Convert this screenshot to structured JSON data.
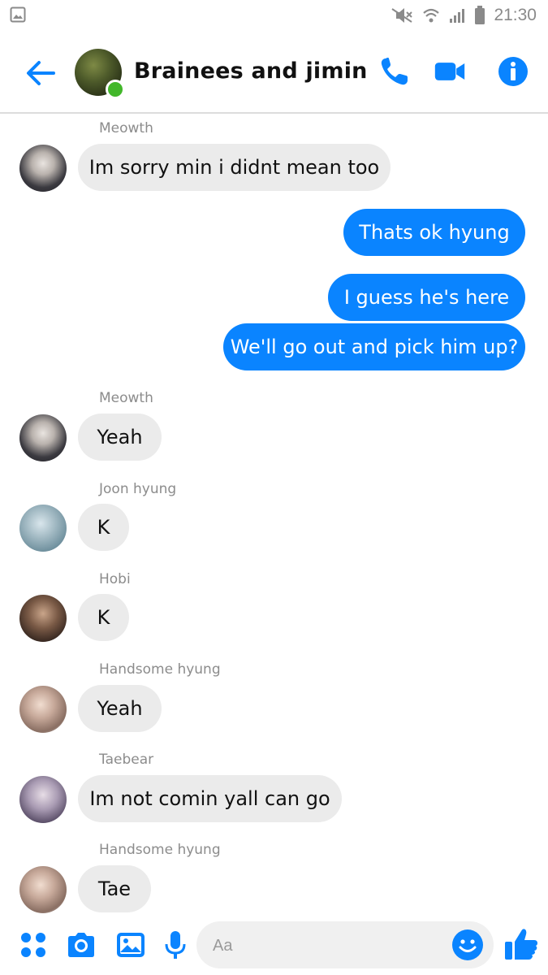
{
  "status_bar": {
    "time": "21:30",
    "icons": [
      "gallery-icon",
      "mute-icon",
      "wifi-icon",
      "signal-icon",
      "battery-icon"
    ]
  },
  "header": {
    "title": "Brainees and jimin",
    "online": true,
    "icons": [
      "back-arrow-icon",
      "phone-icon",
      "video-camera-icon",
      "info-icon"
    ]
  },
  "messages": [
    {
      "sender": "Meowth",
      "text": "Im sorry min i didnt mean too",
      "direction": "incoming"
    },
    {
      "text": "Thats ok hyung",
      "direction": "outgoing"
    },
    {
      "text": "I guess he's here",
      "direction": "outgoing"
    },
    {
      "text": "We'll go out and pick him up?",
      "direction": "outgoing"
    },
    {
      "sender": "Meowth",
      "text": "Yeah",
      "direction": "incoming"
    },
    {
      "sender": "Joon hyung",
      "text": "K",
      "direction": "incoming"
    },
    {
      "sender": "Hobi",
      "text": "K",
      "direction": "incoming"
    },
    {
      "sender": "Handsome hyung",
      "text": "Yeah",
      "direction": "incoming"
    },
    {
      "sender": "Taebear",
      "text": "Im not comin yall can go",
      "direction": "incoming"
    },
    {
      "sender": "Handsome hyung",
      "text": "Tae",
      "direction": "incoming"
    }
  ],
  "composer": {
    "placeholder": "Aa",
    "icons": [
      "apps-icon",
      "camera-icon",
      "image-icon",
      "microphone-icon",
      "emoji-icon",
      "thumbs-up-icon"
    ]
  },
  "colors": {
    "accent": "#0a84ff",
    "incoming_bubble": "#ebebeb",
    "sender_label": "#8c8c8c"
  }
}
